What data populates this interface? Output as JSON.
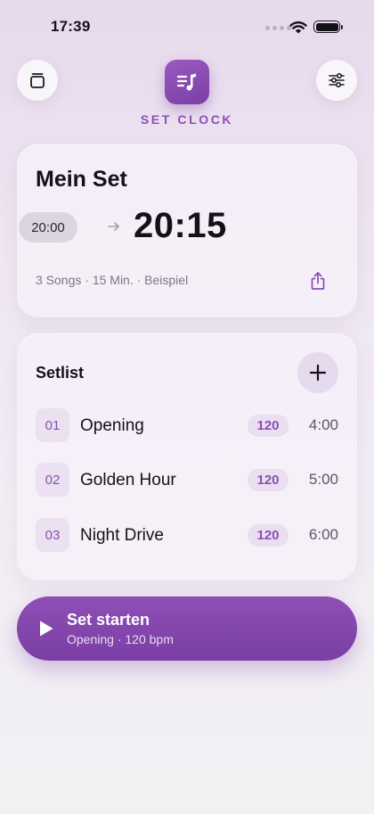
{
  "status_bar": {
    "time": "17:39"
  },
  "header": {
    "app_title": "SET CLOCK"
  },
  "set": {
    "name": "Mein Set",
    "start_time": "20:00",
    "end_time": "20:15",
    "meta": "3 Songs · 15 Min. · Beispiel"
  },
  "setlist": {
    "title": "Setlist",
    "songs": [
      {
        "number": "01",
        "title": "Opening",
        "bpm": "120",
        "duration": "4:00"
      },
      {
        "number": "02",
        "title": "Golden Hour",
        "bpm": "120",
        "duration": "5:00"
      },
      {
        "number": "03",
        "title": "Night Drive",
        "bpm": "120",
        "duration": "6:00"
      }
    ]
  },
  "start_button": {
    "label": "Set starten",
    "subtitle": "Opening · 120 bpm"
  },
  "colors": {
    "accent": "#8a4fb3",
    "button": "#7a3ea4"
  }
}
